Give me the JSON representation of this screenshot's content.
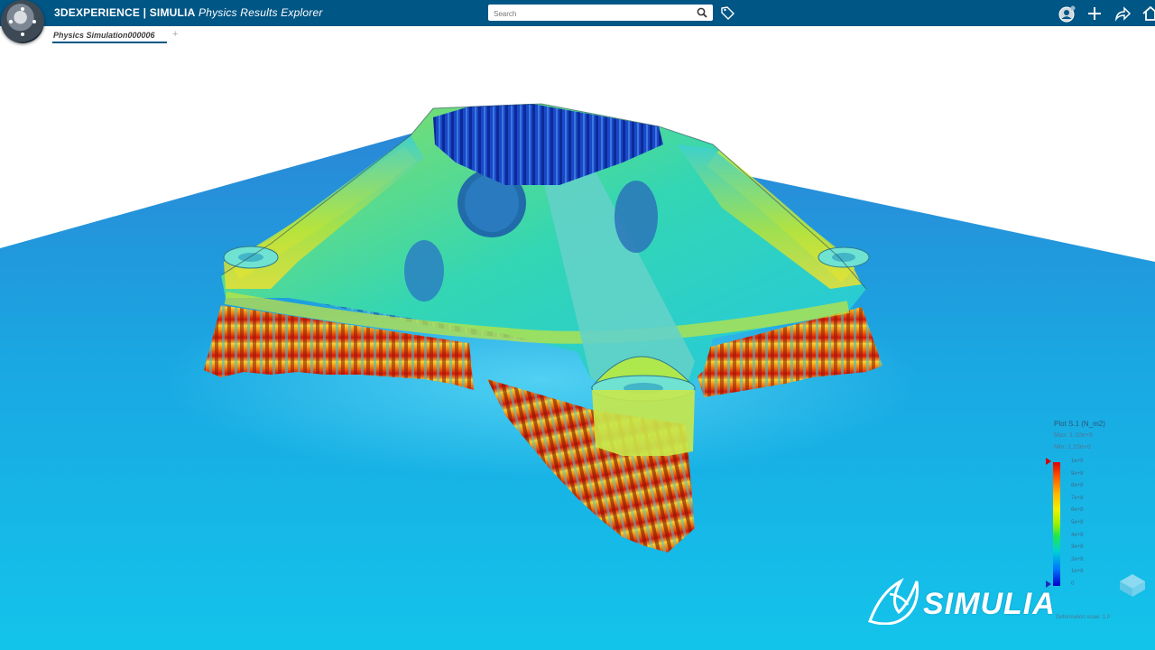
{
  "header": {
    "brand": "3DEXPERIENCE | SIMULIA",
    "app_name": "Physics Results Explorer",
    "search_placeholder": "Search"
  },
  "tabs": [
    {
      "label": "Physics Simulation000006",
      "active": true
    }
  ],
  "tab_add_label": "+",
  "legend": {
    "title": "Plot S.1 (N_m2)",
    "max": "Max: 1.10e+9",
    "min": "Min: 1.15e+0",
    "labels": [
      "1e+9",
      "9e+8",
      "8e+8",
      "7e+8",
      "6e+8",
      "5e+8",
      "4e+8",
      "3e+8",
      "2e+8",
      "1e+8",
      "0"
    ],
    "scale_note": "Deformation scale: 1.0"
  },
  "watermark": "SIMULIA",
  "colors": {
    "header_bg": "#005685",
    "accent": "#005685",
    "floor": "#19aee0"
  },
  "icons": [
    "compass-icon",
    "search-icon",
    "tag-icon",
    "user-icon",
    "add-icon",
    "share-icon",
    "home-icon",
    "view-cube-icon",
    "ds-logo-icon"
  ]
}
